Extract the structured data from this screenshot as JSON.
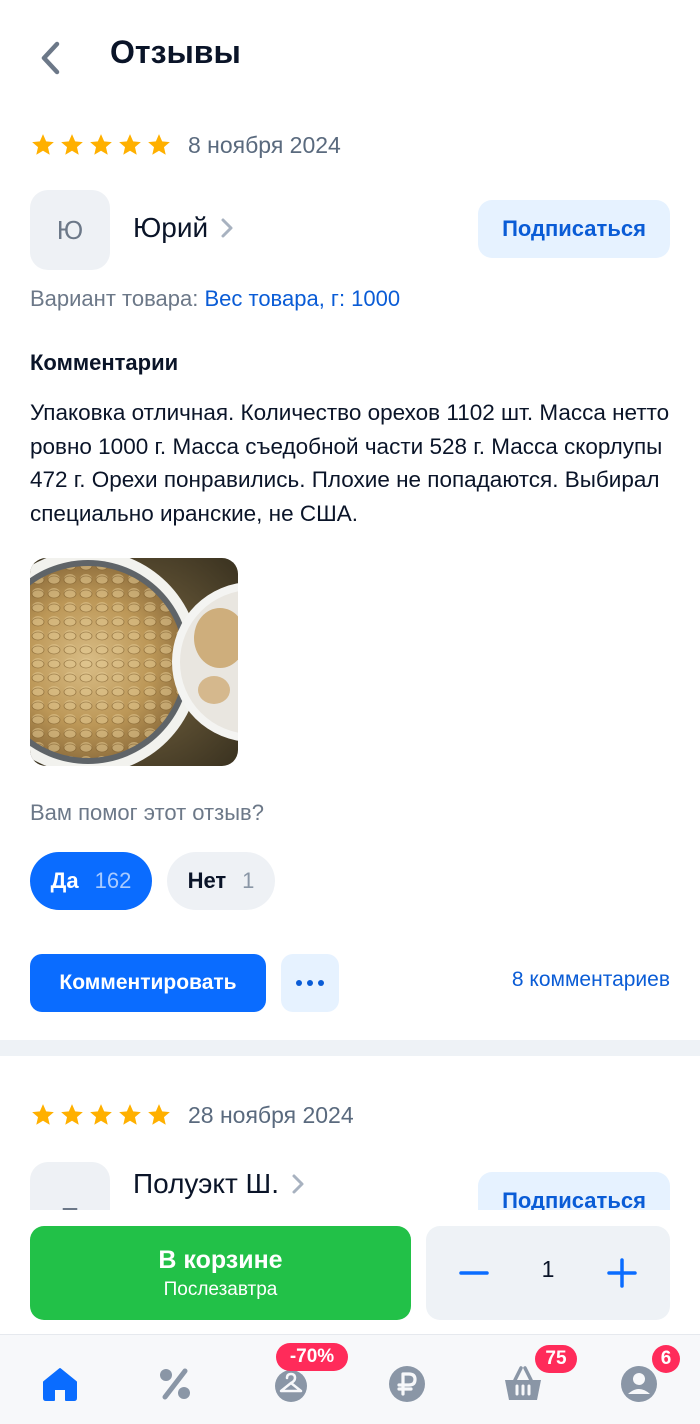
{
  "header": {
    "title": "Отзывы",
    "back_icon": "chevron-left-icon"
  },
  "colors": {
    "accent": "#0a6cff",
    "link": "#0a5cd6",
    "star": "#ffb000",
    "cart_green": "#22c148",
    "badge": "#ff2b5a"
  },
  "reviews": [
    {
      "rating": 5,
      "date": "8 ноября 2024",
      "author_initial": "Ю",
      "author_name": "Юрий",
      "subscribe_label": "Подписаться",
      "variant_label": "Вариант товара:",
      "variant_value": "Вес товара, г: 1000",
      "comments_heading": "Комментарии",
      "comment_text": "Упаковка отличная. Количество орехов 1102 шт. Масса нетто ровно 1000 г. Масса съедобной части 528 г. Масса скорлупы 472 г. Орехи понравились. Плохие не попадаются. Выбирал специально иранские, не США.",
      "helpful_question": "Вам помог этот отзыв?",
      "yes_label": "Да",
      "yes_count": "162",
      "no_label": "Нет",
      "no_count": "1",
      "comment_button": "Комментировать",
      "comments_link": "8 комментариев"
    },
    {
      "rating": 5,
      "date": "28 ноября 2024",
      "author_initial": "П",
      "author_name": "Полуэкт Ш.",
      "subscribe_label": "Подписаться"
    }
  ],
  "cart": {
    "button_label": "В корзине",
    "button_sublabel": "Послезавтра",
    "quantity": "1"
  },
  "tabbar": {
    "items": [
      {
        "icon": "home-icon",
        "active": true
      },
      {
        "icon": "percent-icon",
        "active": false
      },
      {
        "icon": "hanger-icon",
        "badge": "-70%"
      },
      {
        "icon": "ruble-icon"
      },
      {
        "icon": "basket-icon",
        "badge": "75"
      },
      {
        "icon": "profile-icon",
        "badge": "6"
      }
    ]
  }
}
